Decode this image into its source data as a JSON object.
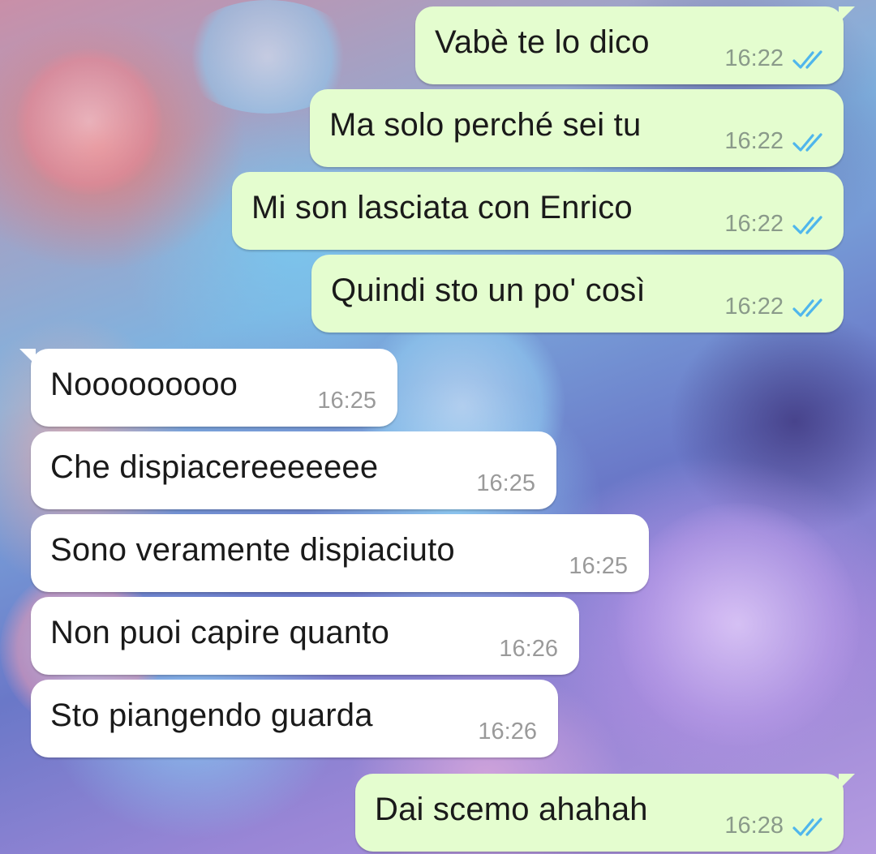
{
  "conversation": {
    "messages": [
      {
        "direction": "out",
        "text": "Vabè te lo dico",
        "time": "16:22",
        "status": "read",
        "tick_icon": "double-check-icon"
      },
      {
        "direction": "out",
        "text": "Ma solo perché sei tu",
        "time": "16:22",
        "status": "read",
        "tick_icon": "double-check-icon"
      },
      {
        "direction": "out",
        "text": "Mi son lasciata con Enrico",
        "time": "16:22",
        "status": "read",
        "tick_icon": "double-check-icon"
      },
      {
        "direction": "out",
        "text": "Quindi sto un po' così",
        "time": "16:22",
        "status": "read",
        "tick_icon": "double-check-icon"
      },
      {
        "direction": "in",
        "text": "Nooooooooo",
        "time": "16:25"
      },
      {
        "direction": "in",
        "text": "Che dispiacereeeeeee",
        "time": "16:25"
      },
      {
        "direction": "in",
        "text": "Sono veramente dispiaciuto",
        "time": "16:25"
      },
      {
        "direction": "in",
        "text": "Non puoi capire quanto",
        "time": "16:26"
      },
      {
        "direction": "in",
        "text": "Sto piangendo guarda",
        "time": "16:26"
      },
      {
        "direction": "out",
        "text": "Dai scemo ahahah",
        "time": "16:28",
        "status": "read",
        "tick_icon": "double-check-icon"
      }
    ]
  },
  "colors": {
    "outgoing_bubble": "#e4fdcf",
    "incoming_bubble": "#ffffff",
    "read_tick": "#4fb6ec",
    "timestamp": "#8a9a8a"
  }
}
